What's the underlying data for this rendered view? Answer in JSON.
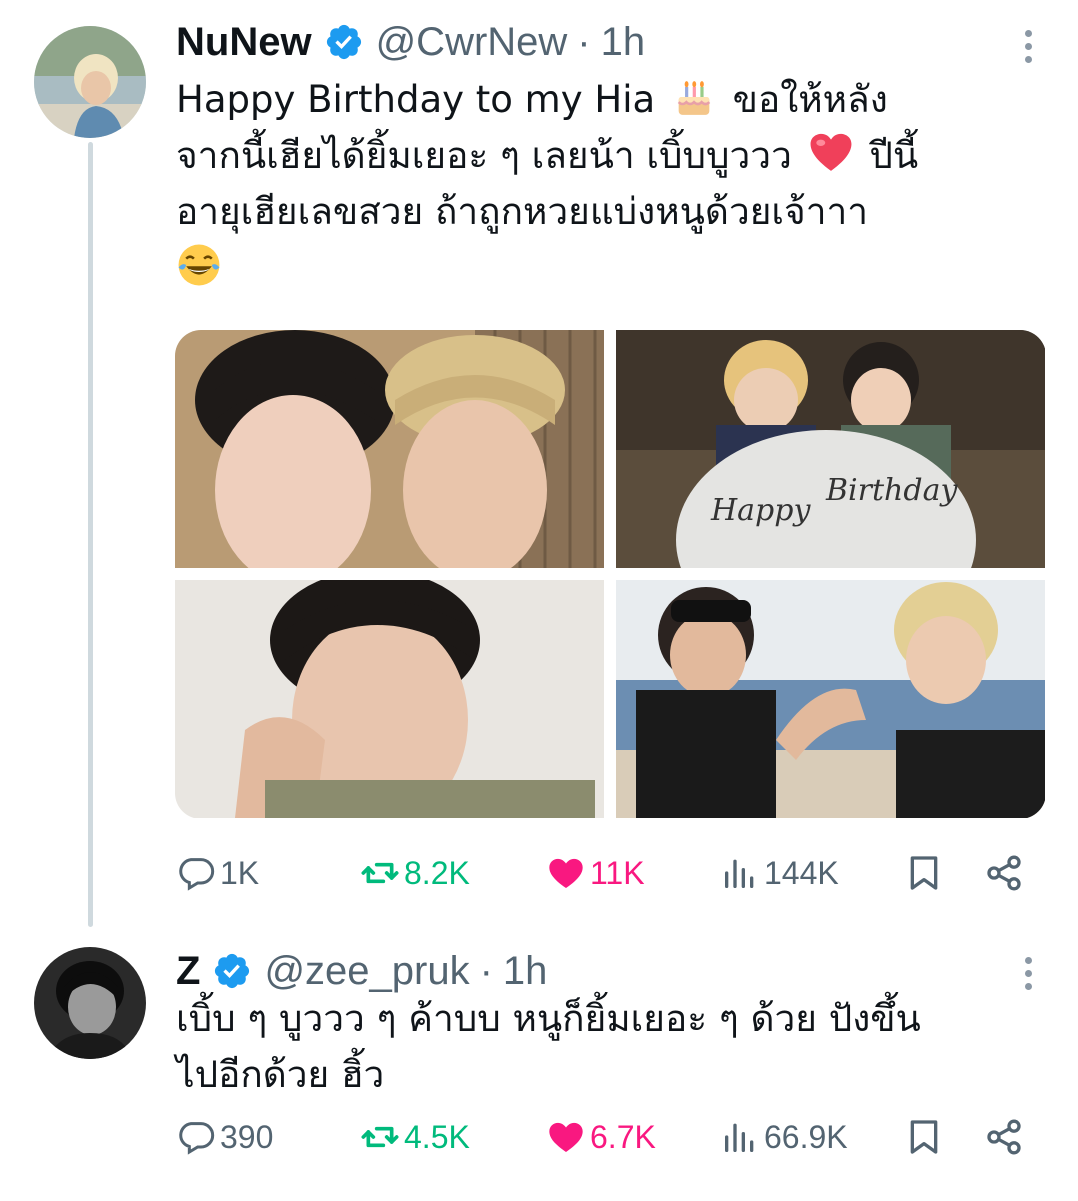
{
  "tweets": [
    {
      "name": "NuNew",
      "handle": "@CwrNew",
      "separator": "·",
      "time": "1h",
      "text_line1": "Happy Birthday to my Hia ",
      "text_line1b": " ขอให้หลัง",
      "text_line2": "จากนี้เฮียได้ยิ้มเยอะ ๆ เลยน้า เบิ้บบูววว ",
      "text_line2b": " ปีนี้",
      "text_line3": "อายุเฮียเลขสวย ถ้าถูกหวยแบ่งหนูด้วยเจ้าาา",
      "emojis": [
        "birthday-cake",
        "red-heart",
        "tears-of-joy"
      ],
      "stats": {
        "replies": "1K",
        "reposts": "8.2K",
        "likes": "11K",
        "views": "144K"
      },
      "photo_text": {
        "balloon_line1": "Happy",
        "balloon_line2": "Birthday"
      },
      "colors": {
        "repost": "#00ba7c",
        "like": "#f91880",
        "muted": "#536471",
        "verified": "#1d9bf0"
      }
    },
    {
      "name": "Z",
      "handle": "@zee_pruk",
      "separator": "·",
      "time": "1h",
      "text_line1": "เบิ้บ ๆ บูววว ๆ ค้าบบ หนูก็ยิ้มเยอะ ๆ ด้วย ปังขึ้น",
      "text_line2": "ไปอีกด้วย ฮิ้ว",
      "stats": {
        "replies": "390",
        "reposts": "4.5K",
        "likes": "6.7K",
        "views": "66.9K"
      }
    }
  ]
}
